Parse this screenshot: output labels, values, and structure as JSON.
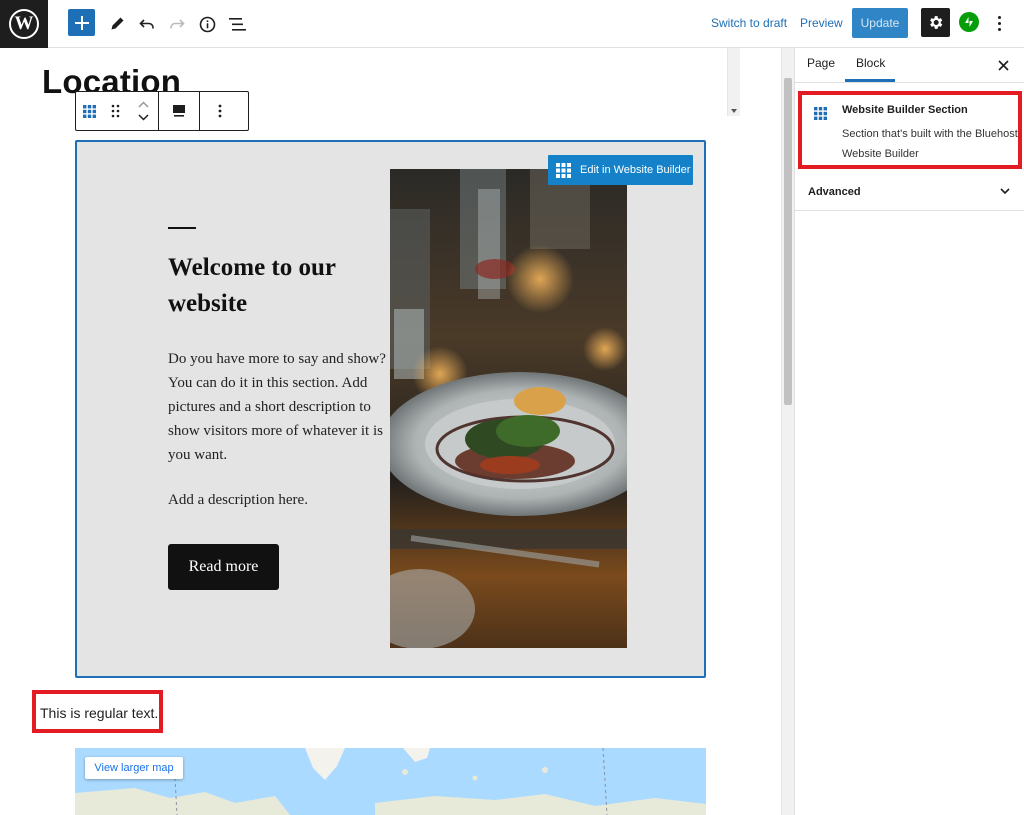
{
  "topbar": {
    "switch_to_draft": "Switch to draft",
    "preview": "Preview",
    "update": "Update"
  },
  "editor": {
    "page_title": "Location",
    "section": {
      "edit_button": "Edit in Website Builder",
      "heading": "Welcome to our website",
      "body": "Do you have more to say and show? You can do it in this section. Add pictures and a short description to show visitors more of whatever it is you want.",
      "description": "Add a description here.",
      "button": "Read more"
    },
    "regular_text": "This is regular text.",
    "map": {
      "view_larger": "View larger map"
    }
  },
  "sidebar": {
    "tabs": [
      "Page",
      "Block"
    ],
    "active_tab": "Block",
    "block_card": {
      "title": "Website Builder Section",
      "description": "Section that's built with the Bluehost Website Builder"
    },
    "advanced": "Advanced"
  },
  "colors": {
    "accent": "#1e6fb5",
    "highlight": "#e31b23",
    "jetpack": "#069e08"
  },
  "icons": [
    "wordpress-logo-icon",
    "plus-icon",
    "pencil-icon",
    "undo-icon",
    "redo-icon",
    "info-icon",
    "list-view-icon",
    "gear-icon",
    "jetpack-icon",
    "more-vertical-icon",
    "grid-block-icon",
    "drag-handle-icon",
    "chevron-up-icon",
    "chevron-down-icon",
    "align-icon",
    "close-icon"
  ]
}
